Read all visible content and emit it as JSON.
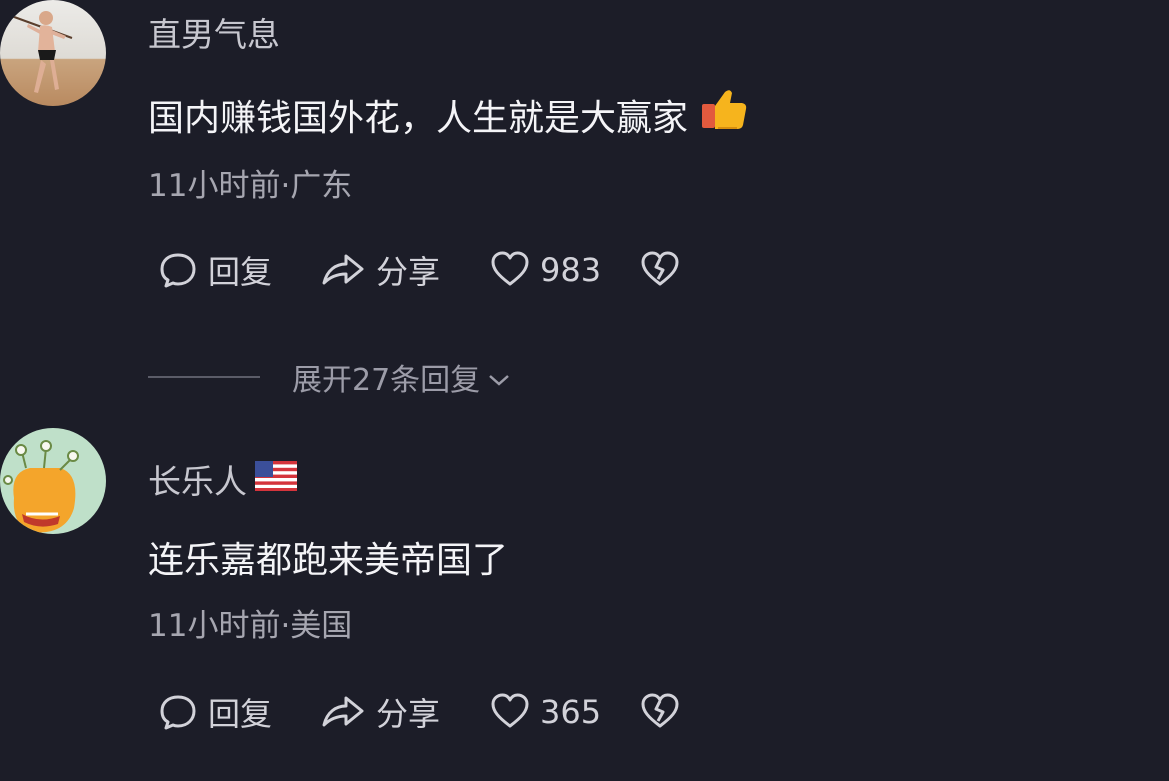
{
  "colors": {
    "background": "#1c1d28",
    "text_primary": "#f4f4f7",
    "text_secondary": "#a6a6b0",
    "username": "#c7c7cf"
  },
  "comments": [
    {
      "avatar": "avatar-photo-dancer",
      "username": "直男气息",
      "badge": "",
      "text": "国内赚钱国外花，人生就是大赢家",
      "emoji": "thumbs-up-icon",
      "meta": "11小时前·广东",
      "actions": {
        "reply": "回复",
        "share": "分享",
        "likes": "983"
      },
      "expand_label": "展开27条回复"
    },
    {
      "avatar": "avatar-cartoon-monster",
      "username": "长乐人",
      "badge": "us-flag-icon",
      "text": "连乐嘉都跑来美帝国了",
      "emoji": "",
      "meta": "11小时前·美国",
      "actions": {
        "reply": "回复",
        "share": "分享",
        "likes": "365"
      }
    }
  ]
}
